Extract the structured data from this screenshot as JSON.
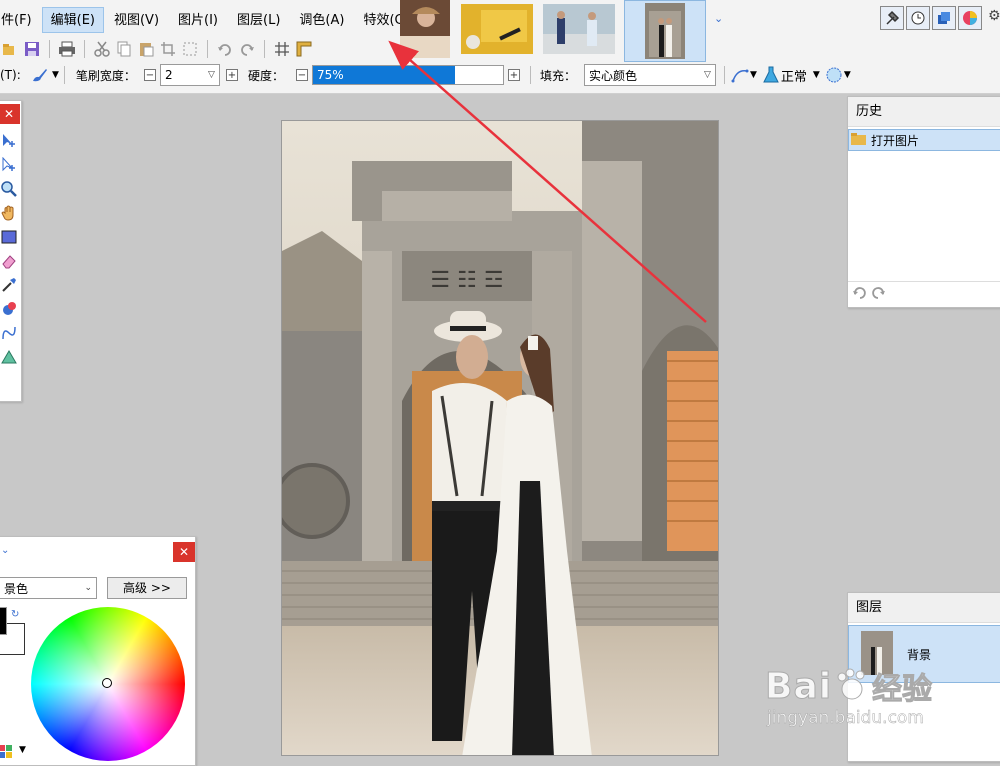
{
  "menu": [
    "件(F)",
    "编辑(E)",
    "视图(V)",
    "图片(I)",
    "图层(L)",
    "调色(A)",
    "特效(C)"
  ],
  "menu_active_index": 1,
  "toolbar2": {
    "tool_label": "(T):",
    "brush_width_label": "笔刷宽度：",
    "brush_width_value": "2",
    "hardness_label": "硬度：",
    "hardness_value": "75%",
    "hardness_fraction": 0.75,
    "fill_label": "填充：",
    "fill_value": "实心颜色",
    "blend_value": "正常"
  },
  "history_panel": {
    "title": "历史",
    "items": [
      "打开图片"
    ]
  },
  "layers_panel": {
    "title": "图层",
    "layers": [
      "背景"
    ]
  },
  "color_panel": {
    "mode_value": "景色",
    "advanced_button": "高级 >>"
  },
  "watermark": {
    "logo_text": "Bai",
    "logo_text_cn": "经验",
    "url": "jingyan.baidu.com"
  },
  "colors": {
    "accent": "#0f78d7",
    "selection": "#cde2f7",
    "arrow": "#e8323c"
  }
}
